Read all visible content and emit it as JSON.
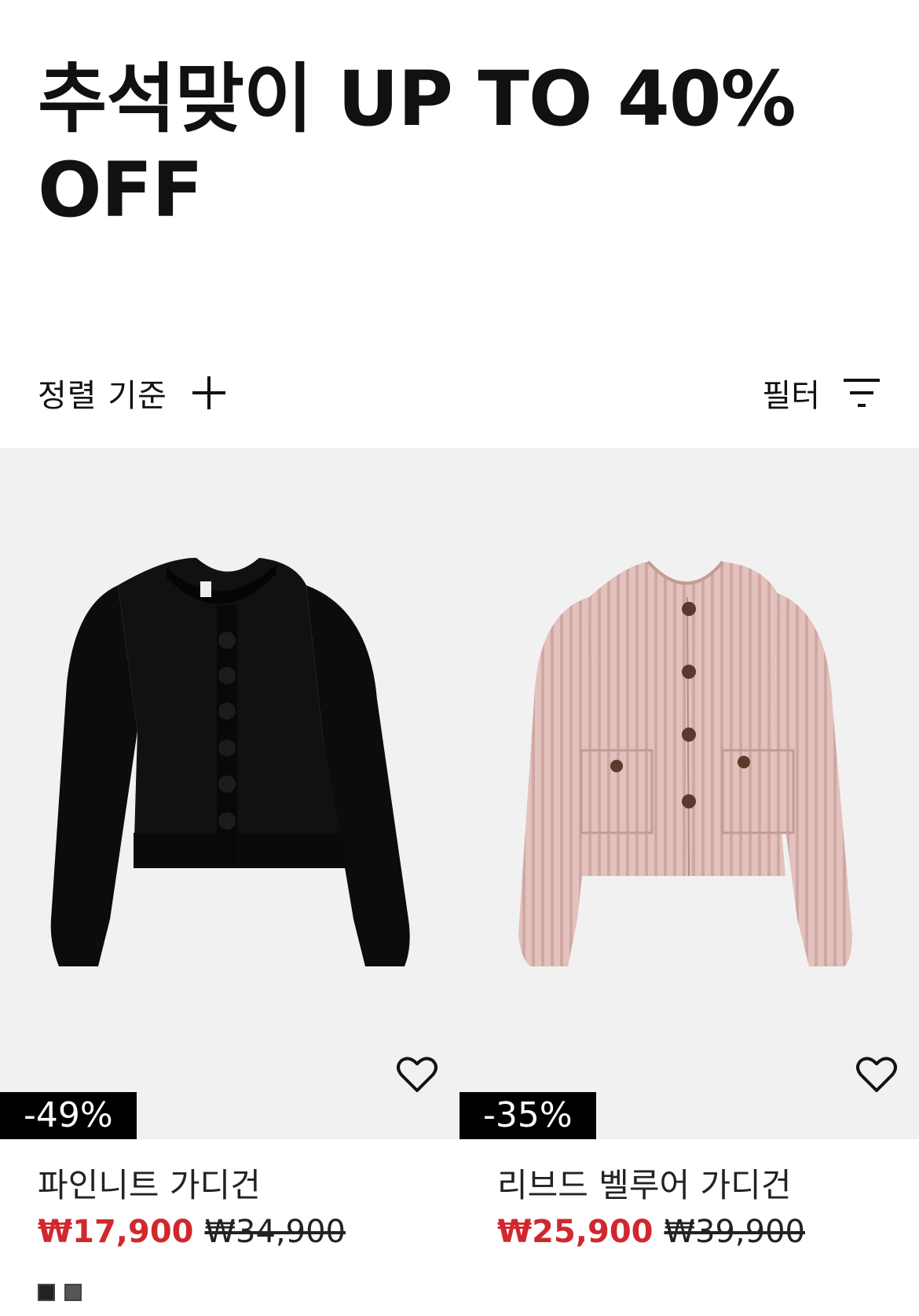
{
  "page": {
    "title": "추석맞이 UP TO 40% OFF"
  },
  "toolbar": {
    "sort_label": "정렬 기준",
    "sort_icon": "plus-icon",
    "filter_label": "필터",
    "filter_icon": "filter-icon"
  },
  "colors": {
    "sale_price": "#d0282e",
    "badge_bg": "#000000",
    "image_bg": "#f1f1f1"
  },
  "products": [
    {
      "name": "파인니트 가디건",
      "discount": "-49%",
      "sale_price": "₩17,900",
      "original_price": "₩34,900",
      "wishlist_icon": "heart-icon",
      "color": "black",
      "swatches": [
        "#222222",
        "#555555"
      ]
    },
    {
      "name": "리브드 벨루어 가디건",
      "discount": "-35%",
      "sale_price": "₩25,900",
      "original_price": "₩39,900",
      "wishlist_icon": "heart-icon",
      "color": "pink"
    }
  ]
}
